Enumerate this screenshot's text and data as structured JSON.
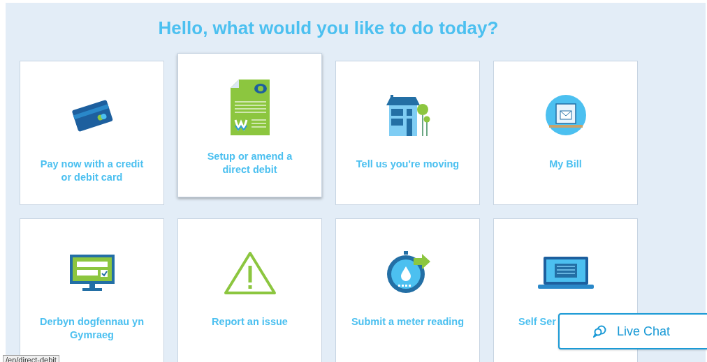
{
  "heading": "Hello, what would you like to do today?",
  "cards": [
    {
      "kind": "card",
      "label": "Pay now with a credit or debit card",
      "highlighted": false
    },
    {
      "kind": "document",
      "label": "Setup or amend a direct debit",
      "highlighted": true
    },
    {
      "kind": "house",
      "label": "Tell us you're moving",
      "highlighted": false
    },
    {
      "kind": "bill",
      "label": "My Bill",
      "highlighted": false
    },
    {
      "kind": "monitor",
      "label": "Derbyn dogfennau yn Gymraeg",
      "highlighted": false
    },
    {
      "kind": "warning",
      "label": "Report an issue",
      "highlighted": false
    },
    {
      "kind": "meter",
      "label": "Submit a meter reading",
      "highlighted": false
    },
    {
      "kind": "laptop",
      "label": "Self Ser",
      "highlighted": false
    }
  ],
  "live_chat": {
    "label": "Live Chat"
  },
  "status_url": "/en/direct-debit"
}
